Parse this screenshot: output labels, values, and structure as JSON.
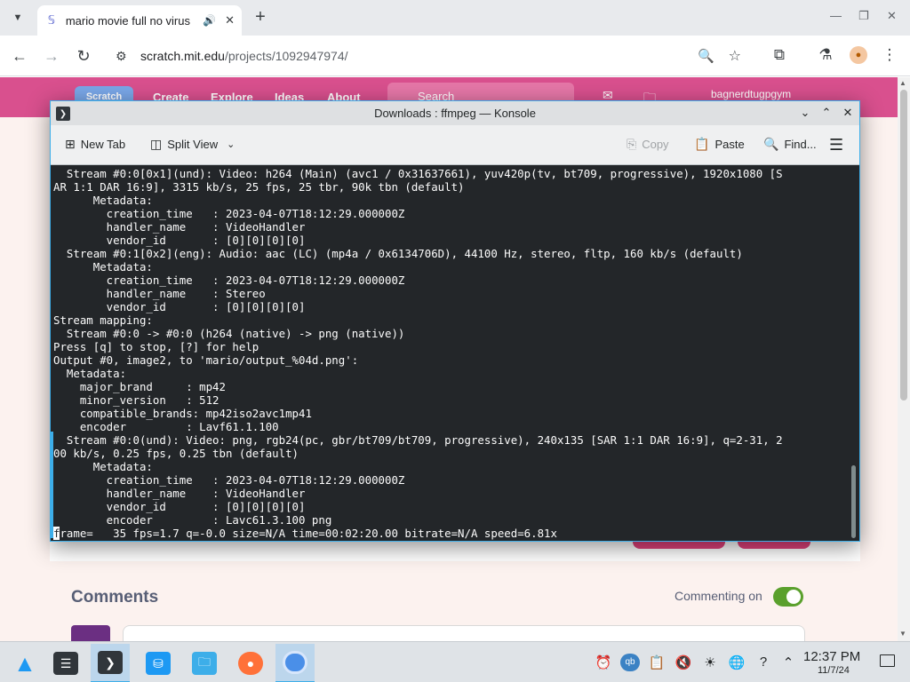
{
  "browser": {
    "tab_title": "mario movie full no virus",
    "tab_audio_icon": "speaker-icon",
    "url_host": "scratch.mit.edu",
    "url_path": "/projects/1092947974/"
  },
  "scratch": {
    "logo": "Scratch",
    "nav": [
      "Create",
      "Explore",
      "Ideas",
      "About"
    ],
    "search_placeholder": "Search",
    "username": "bagnerdtugpgym",
    "comments_title": "Comments",
    "commenting_label": "Commenting on",
    "commenting_enabled": true
  },
  "konsole": {
    "title": "Downloads : ffmpeg — Konsole",
    "toolbar": {
      "new_tab": "New Tab",
      "split_view": "Split View",
      "copy": "Copy",
      "paste": "Paste",
      "find": "Find..."
    },
    "lines": [
      "  Stream #0:0[0x1](und): Video: h264 (Main) (avc1 / 0x31637661), yuv420p(tv, bt709, progressive), 1920x1080 [S",
      "AR 1:1 DAR 16:9], 3315 kb/s, 25 fps, 25 tbr, 90k tbn (default)",
      "      Metadata:",
      "        creation_time   : 2023-04-07T18:12:29.000000Z",
      "        handler_name    : VideoHandler",
      "        vendor_id       : [0][0][0][0]",
      "  Stream #0:1[0x2](eng): Audio: aac (LC) (mp4a / 0x6134706D), 44100 Hz, stereo, fltp, 160 kb/s (default)",
      "      Metadata:",
      "        creation_time   : 2023-04-07T18:12:29.000000Z",
      "        handler_name    : Stereo",
      "        vendor_id       : [0][0][0][0]",
      "Stream mapping:",
      "  Stream #0:0 -> #0:0 (h264 (native) -> png (native))",
      "Press [q] to stop, [?] for help",
      "Output #0, image2, to 'mario/output_%04d.png':",
      "  Metadata:",
      "    major_brand     : mp42",
      "    minor_version   : 512",
      "    compatible_brands: mp42iso2avc1mp41",
      "    encoder         : Lavf61.1.100",
      "  Stream #0:0(und): Video: png, rgb24(pc, gbr/bt709/bt709, progressive), 240x135 [SAR 1:1 DAR 16:9], q=2-31, 2",
      "00 kb/s, 0.25 fps, 0.25 tbn (default)",
      "      Metadata:",
      "        creation_time   : 2023-04-07T18:12:29.000000Z",
      "        handler_name    : VideoHandler",
      "        vendor_id       : [0][0][0][0]",
      "        encoder         : Lavc61.3.100 png"
    ],
    "cursor_char": "f",
    "progress_line": "rame=   35 fps=1.7 q=-0.0 size=N/A time=00:02:20.00 bitrate=N/A speed=6.81x"
  },
  "taskbar": {
    "time": "12:37 PM",
    "date": "11/7/24",
    "apps": [
      "app-launcher",
      "system-settings",
      "konsole",
      "discover",
      "dolphin",
      "firefox",
      "chromium"
    ]
  },
  "colors": {
    "scratch_nav": "#d9508e",
    "konsole_bg": "#232629",
    "accent": "#3daee9",
    "toggle_on": "#5aa02c"
  }
}
